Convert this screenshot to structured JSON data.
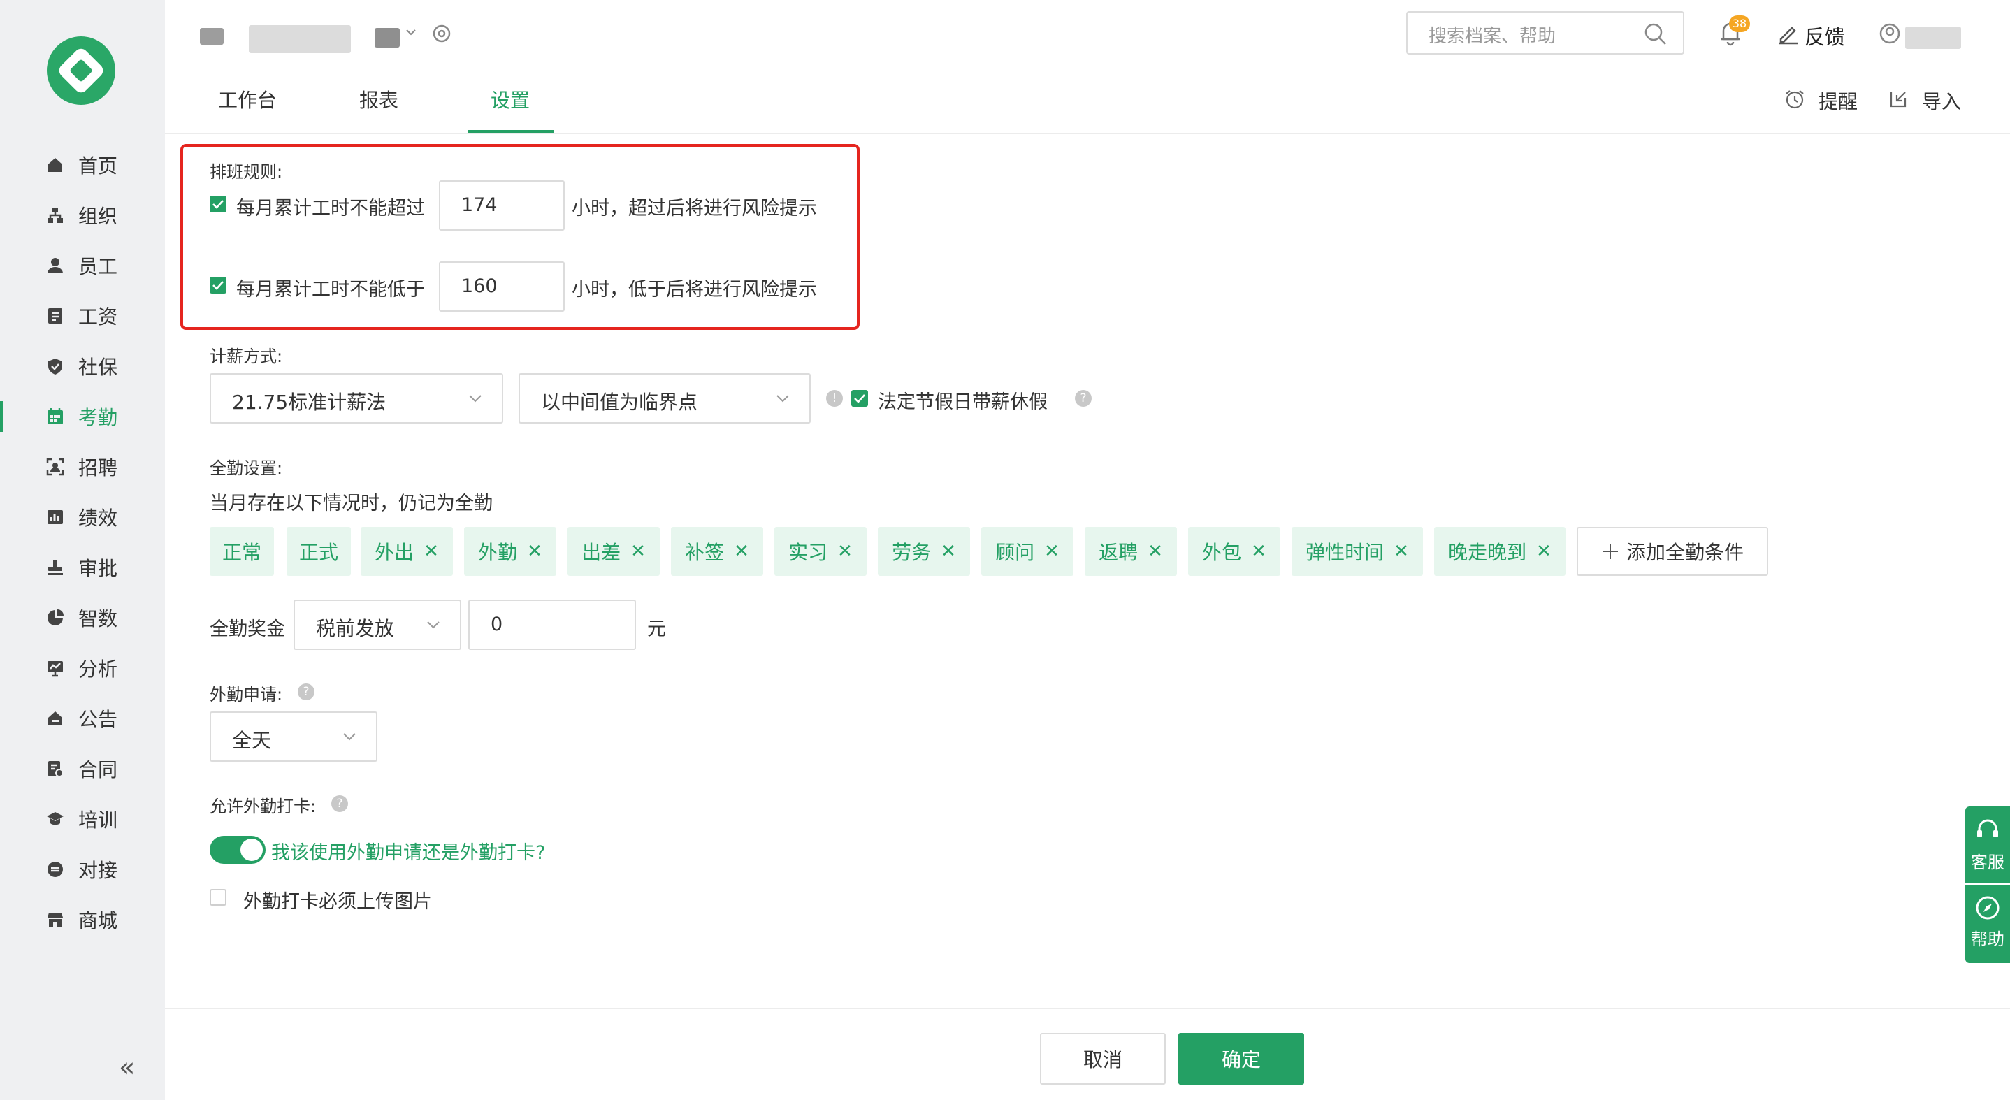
{
  "sidebar": {
    "items": [
      {
        "label": "首页",
        "icon": "home-icon"
      },
      {
        "label": "组织",
        "icon": "org-icon"
      },
      {
        "label": "员工",
        "icon": "user-icon"
      },
      {
        "label": "工资",
        "icon": "salary-icon"
      },
      {
        "label": "社保",
        "icon": "shield-icon"
      },
      {
        "label": "考勤",
        "icon": "calendar-icon",
        "active": true
      },
      {
        "label": "招聘",
        "icon": "recruit-icon"
      },
      {
        "label": "绩效",
        "icon": "chart-icon"
      },
      {
        "label": "审批",
        "icon": "stamp-icon"
      },
      {
        "label": "智数",
        "icon": "pie-icon"
      },
      {
        "label": "分析",
        "icon": "analysis-icon"
      },
      {
        "label": "公告",
        "icon": "notice-icon"
      },
      {
        "label": "合同",
        "icon": "contract-icon"
      },
      {
        "label": "培训",
        "icon": "training-icon"
      },
      {
        "label": "对接",
        "icon": "link-icon"
      },
      {
        "label": "商城",
        "icon": "store-icon"
      }
    ],
    "collapse_glyph": "«"
  },
  "header": {
    "search_placeholder": "搜索档案、帮助",
    "notification_count": "38",
    "feedback_label": "反馈",
    "tabs": [
      "工作台",
      "报表",
      "设置"
    ],
    "remind_label": "提醒",
    "import_label": "导入"
  },
  "schedule": {
    "title": "排班规则:",
    "rule_max_label": "每月累计工时不能超过",
    "rule_max_value": "174",
    "rule_max_suffix": "小时，超过后将进行风险提示",
    "rule_min_label": "每月累计工时不能低于",
    "rule_min_value": "160",
    "rule_min_suffix": "小时，低于后将进行风险提示"
  },
  "pay": {
    "title": "计薪方式:",
    "method": "21.75标准计薪法",
    "threshold": "以中间值为临界点",
    "holiday_label": "法定节假日带薪休假"
  },
  "full_attendance": {
    "title": "全勤设置:",
    "desc": "当月存在以下情况时，仍记为全勤",
    "tags": [
      {
        "label": "正常",
        "removable": false
      },
      {
        "label": "正式",
        "removable": false
      },
      {
        "label": "外出",
        "removable": true
      },
      {
        "label": "外勤",
        "removable": true
      },
      {
        "label": "出差",
        "removable": true
      },
      {
        "label": "补签",
        "removable": true
      },
      {
        "label": "实习",
        "removable": true
      },
      {
        "label": "劳务",
        "removable": true
      },
      {
        "label": "顾问",
        "removable": true
      },
      {
        "label": "返聘",
        "removable": true
      },
      {
        "label": "外包",
        "removable": true
      },
      {
        "label": "弹性时间",
        "removable": true
      },
      {
        "label": "晚走晚到",
        "removable": true
      }
    ],
    "remove_glyph": "✕",
    "add_label": "添加全勤条件",
    "bonus_label": "全勤奖金",
    "bonus_mode": "税前发放",
    "bonus_value": "0",
    "bonus_unit": "元"
  },
  "field_work": {
    "title": "外勤申请:",
    "value": "全天",
    "punch_title": "允许外勤打卡:",
    "toggle_link": "我该使用外勤申请还是外勤打卡?",
    "photo_label": "外勤打卡必须上传图片"
  },
  "footer": {
    "cancel": "取消",
    "confirm": "确定"
  },
  "float_panel": {
    "service": "客服",
    "help": "帮助"
  },
  "colors": {
    "accent": "#24a064",
    "highlight_box": "#e5251f",
    "tag_bg": "#e7f6ee"
  }
}
